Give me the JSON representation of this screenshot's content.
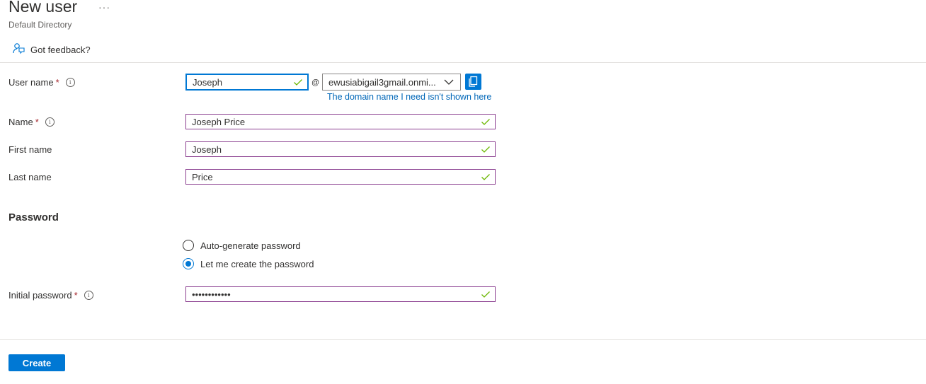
{
  "header": {
    "title": "New user",
    "more_label": "···",
    "subtitle": "Default Directory",
    "feedback_label": "Got feedback?"
  },
  "form": {
    "username": {
      "label": "User name",
      "required_mark": "*",
      "value": "Joseph"
    },
    "at_sign": "@",
    "domain": {
      "value": "ewusiabigail3gmail.onmi...",
      "link": "The domain name I need isn't shown here"
    },
    "name": {
      "label": "Name",
      "required_mark": "*",
      "value": "Joseph Price"
    },
    "first_name": {
      "label": "First name",
      "value": "Joseph"
    },
    "last_name": {
      "label": "Last name",
      "value": "Price"
    }
  },
  "password": {
    "section_title": "Password",
    "options": [
      {
        "label": "Auto-generate password",
        "selected": false
      },
      {
        "label": "Let me create the password",
        "selected": true
      }
    ],
    "initial": {
      "label": "Initial password",
      "required_mark": "*",
      "value": "••••••••••••"
    }
  },
  "footer": {
    "create_label": "Create"
  },
  "colors": {
    "accent": "#0078d4",
    "valid_border": "#8a3d8f",
    "check": "#6bb700",
    "required": "#a4262c",
    "link": "#0067b8"
  },
  "icons": [
    "ellipsis-icon",
    "feedback-icon",
    "info-icon",
    "checkmark-icon",
    "chevron-down-icon",
    "copy-icon"
  ]
}
